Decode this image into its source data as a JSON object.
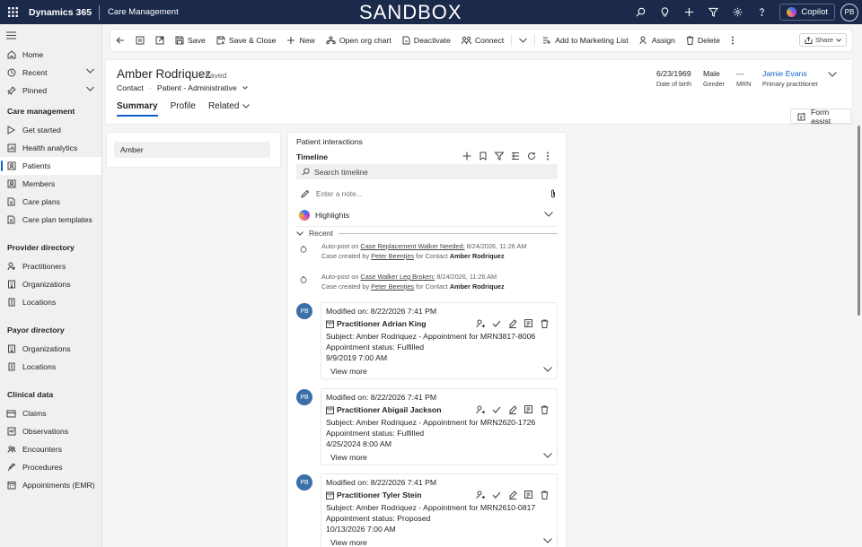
{
  "colors": {
    "topbar": "#1b2a4a",
    "accent": "#1160c8",
    "avatar": "#3b6fa8"
  },
  "topbar": {
    "app_name": "Dynamics 365",
    "area_name": "Care Management",
    "environment_banner": "SANDBOX",
    "copilot_label": "Copilot",
    "user_initials": "PB",
    "icons": [
      "search-icon",
      "lightbulb-icon",
      "plus-icon",
      "filter-icon",
      "gear-icon",
      "help-icon"
    ]
  },
  "nav": {
    "top_items": [
      {
        "label": "Home",
        "icon": "home-icon"
      },
      {
        "label": "Recent",
        "icon": "clock-icon"
      },
      {
        "label": "Pinned",
        "icon": "pin-icon"
      }
    ],
    "sections": [
      {
        "title": "Care management",
        "items": [
          "Get started",
          "Health analytics",
          "Patients",
          "Members",
          "Care plans",
          "Care plan templates"
        ]
      },
      {
        "title": "Provider directory",
        "items": [
          "Practitioners",
          "Organizations",
          "Locations"
        ]
      },
      {
        "title": "Payor directory",
        "items": [
          "Organizations",
          "Locations"
        ]
      },
      {
        "title": "Clinical data",
        "items": [
          "Claims",
          "Observations",
          "Encounters",
          "Procedures",
          "Appointments (EMR)"
        ]
      }
    ],
    "active_item": "Patients"
  },
  "commands": {
    "save": "Save",
    "save_close": "Save & Close",
    "new": "New",
    "open_org_chart": "Open org chart",
    "deactivate": "Deactivate",
    "connect": "Connect",
    "add_marketing": "Add to Marketing List",
    "assign": "Assign",
    "delete": "Delete",
    "share": "Share"
  },
  "record": {
    "name": "Amber Rodriquez",
    "saved_status": "- Saved",
    "entity": "Contact",
    "form": "Patient - Administrative",
    "fields": [
      {
        "value": "6/23/1969",
        "label": "Date of birth"
      },
      {
        "value": "Male",
        "label": "Gender"
      },
      {
        "value": "---",
        "label": "MRN"
      },
      {
        "value": "Jamie Evans",
        "label": "Primary practitioner"
      }
    ],
    "tabs": [
      "Summary",
      "Profile",
      "Related"
    ],
    "form_assist": "Form assist",
    "first_name_value": "Amber"
  },
  "timeline": {
    "section_title": "Patient interactions",
    "title": "Timeline",
    "search_placeholder": "Search timeline",
    "note_placeholder": "Enter a note...",
    "highlights_label": "Highlights",
    "recent_label": "Recent",
    "autoposts": [
      {
        "prefix": "Auto-post on",
        "case_link": "Case Replacement Walker Needed:",
        "timestamp": "8/24/2026, 11:26 AM",
        "created_by_prefix": "Case created by",
        "author": "Peter Beentjes",
        "contact_prefix": "for Contact",
        "contact": "Amber Rodriquez"
      },
      {
        "prefix": "Auto-post on",
        "case_link": "Case Walker Leg Broken:",
        "timestamp": "8/24/2026, 11:26 AM",
        "created_by_prefix": "Case created by",
        "author": "Peter Beentjes",
        "contact_prefix": "for Contact",
        "contact": "Amber Rodriquez"
      }
    ],
    "activities": [
      {
        "initials": "PB",
        "modified": "Modified on: 8/22/2026 7:41 PM",
        "title": "Practitioner Adrian King",
        "subject": "Subject: Amber Rodriquez - Appointment for MRN3817-8006",
        "status": "Appointment status: Fulfilled",
        "date": "9/9/2019 7:00 AM",
        "view_more": "View more"
      },
      {
        "initials": "PB",
        "modified": "Modified on: 8/22/2026 7:41 PM",
        "title": "Practitioner Abigail Jackson",
        "subject": "Subject: Amber Rodriquez - Appointment for MRN2620-1726",
        "status": "Appointment status: Fulfilled",
        "date": "4/25/2024 8:00 AM",
        "view_more": "View more"
      },
      {
        "initials": "PB",
        "modified": "Modified on: 8/22/2026 7:41 PM",
        "title": "Practitioner Tyler Stein",
        "subject": "Subject: Amber Rodriquez - Appointment for MRN2610-0817",
        "status": "Appointment status: Proposed",
        "date": "10/13/2026 7:00 AM",
        "view_more": "View more"
      }
    ]
  }
}
